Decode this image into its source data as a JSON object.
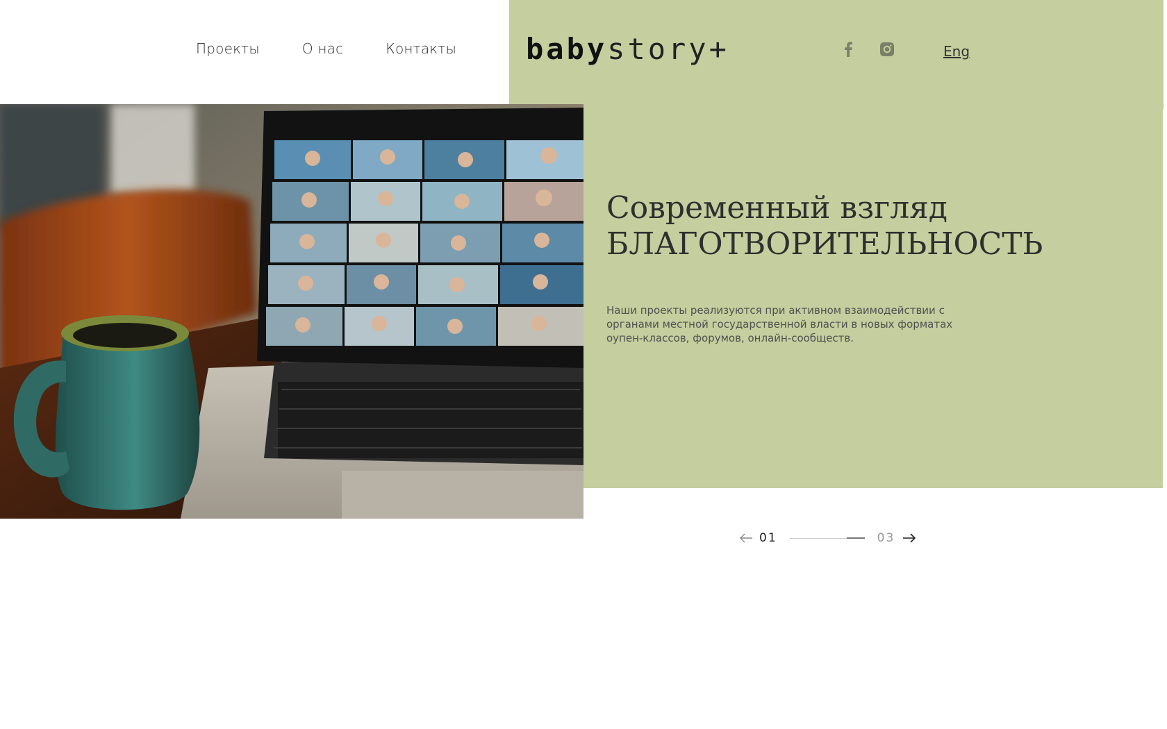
{
  "nav": {
    "items": [
      {
        "label": "Проекты"
      },
      {
        "label": "О нас"
      },
      {
        "label": "Контакты"
      }
    ]
  },
  "logo": {
    "bold": "baby",
    "light": "story+"
  },
  "social": {
    "icons": [
      "facebook-icon",
      "instagram-icon"
    ]
  },
  "lang": {
    "label": "Eng"
  },
  "hero": {
    "title_line1": "Современный взгляд",
    "title_line2": "БЛАГОТВОРИТЕЛЬНОСТЬ",
    "text": "Наши проекты реализуются при активном взаимодействии с органами местной государственной власти в новых форматах оупен-классов, форумов, онлайн-сообществ."
  },
  "slider": {
    "current": "01",
    "total": "03"
  },
  "colors": {
    "panel": "#c4ce9e",
    "text_dark": "#2f2f2f"
  }
}
